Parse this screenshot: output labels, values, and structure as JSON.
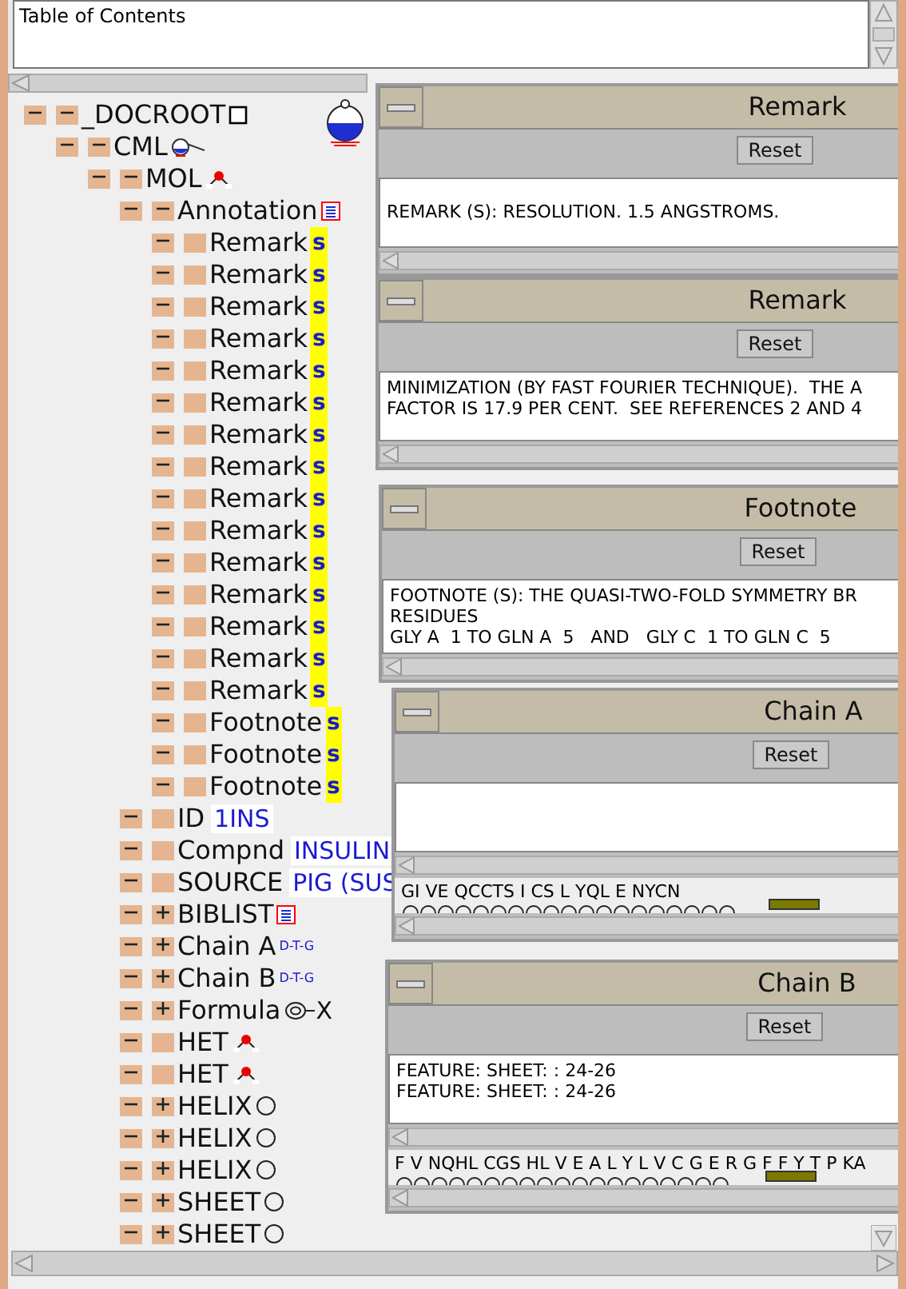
{
  "toc": {
    "title": "Table of Contents"
  },
  "tree": [
    {
      "label": "_DOCROOT",
      "kind": "branch",
      "expanded": true,
      "tag": {
        "kind": "box"
      },
      "children": [
        {
          "label": "CML",
          "kind": "branch",
          "expanded": true,
          "tag": {
            "kind": "flask"
          },
          "children": [
            {
              "label": "MOL",
              "kind": "branch",
              "expanded": true,
              "tag": {
                "kind": "molecule"
              },
              "children": [
                {
                  "label": "Annotation",
                  "kind": "branch",
                  "expanded": true,
                  "tag": {
                    "kind": "list"
                  },
                  "children": [
                    {
                      "label": "Remark",
                      "kind": "leaf",
                      "tag": {
                        "kind": "s",
                        "text": "s"
                      }
                    },
                    {
                      "label": "Remark",
                      "kind": "leaf",
                      "tag": {
                        "kind": "s",
                        "text": "s"
                      }
                    },
                    {
                      "label": "Remark",
                      "kind": "leaf",
                      "tag": {
                        "kind": "s",
                        "text": "s"
                      }
                    },
                    {
                      "label": "Remark",
                      "kind": "leaf",
                      "tag": {
                        "kind": "s",
                        "text": "s"
                      }
                    },
                    {
                      "label": "Remark",
                      "kind": "leaf",
                      "tag": {
                        "kind": "s",
                        "text": "s"
                      }
                    },
                    {
                      "label": "Remark",
                      "kind": "leaf",
                      "tag": {
                        "kind": "s",
                        "text": "s"
                      }
                    },
                    {
                      "label": "Remark",
                      "kind": "leaf",
                      "tag": {
                        "kind": "s",
                        "text": "s"
                      }
                    },
                    {
                      "label": "Remark",
                      "kind": "leaf",
                      "tag": {
                        "kind": "s",
                        "text": "s"
                      }
                    },
                    {
                      "label": "Remark",
                      "kind": "leaf",
                      "tag": {
                        "kind": "s",
                        "text": "s"
                      }
                    },
                    {
                      "label": "Remark",
                      "kind": "leaf",
                      "tag": {
                        "kind": "s",
                        "text": "s"
                      }
                    },
                    {
                      "label": "Remark",
                      "kind": "leaf",
                      "tag": {
                        "kind": "s",
                        "text": "s"
                      }
                    },
                    {
                      "label": "Remark",
                      "kind": "leaf",
                      "tag": {
                        "kind": "s",
                        "text": "s"
                      }
                    },
                    {
                      "label": "Remark",
                      "kind": "leaf",
                      "tag": {
                        "kind": "s",
                        "text": "s"
                      }
                    },
                    {
                      "label": "Remark",
                      "kind": "leaf",
                      "tag": {
                        "kind": "s",
                        "text": "s"
                      }
                    },
                    {
                      "label": "Remark",
                      "kind": "leaf",
                      "tag": {
                        "kind": "s",
                        "text": "s"
                      }
                    },
                    {
                      "label": "Footnote",
                      "kind": "leaf",
                      "tag": {
                        "kind": "s",
                        "text": "s"
                      }
                    },
                    {
                      "label": "Footnote",
                      "kind": "leaf",
                      "tag": {
                        "kind": "s",
                        "text": "s"
                      }
                    },
                    {
                      "label": "Footnote",
                      "kind": "leaf",
                      "tag": {
                        "kind": "s",
                        "text": "s"
                      }
                    }
                  ]
                },
                {
                  "label": "ID",
                  "kind": "leaf",
                  "tag": {
                    "kind": "value",
                    "text": "1INS"
                  }
                },
                {
                  "label": "Compnd",
                  "kind": "leaf",
                  "tag": {
                    "kind": "value",
                    "text": "INSULIN"
                  }
                },
                {
                  "label": "SOURCE",
                  "kind": "leaf",
                  "tag": {
                    "kind": "value",
                    "text": "PIG (SUS"
                  }
                },
                {
                  "label": "BIBLIST",
                  "kind": "branch",
                  "expanded": false,
                  "tag": {
                    "kind": "list"
                  }
                },
                {
                  "label": "Chain A",
                  "kind": "branch",
                  "expanded": false,
                  "tag": {
                    "kind": "dtg",
                    "text": "D-T-G"
                  }
                },
                {
                  "label": "Chain B",
                  "kind": "branch",
                  "expanded": false,
                  "tag": {
                    "kind": "dtg",
                    "text": "D-T-G"
                  }
                },
                {
                  "label": "Formula",
                  "kind": "branch",
                  "expanded": false,
                  "tag": {
                    "kind": "formula",
                    "text": "X"
                  }
                },
                {
                  "label": "HET",
                  "kind": "leaf",
                  "tag": {
                    "kind": "molecule"
                  }
                },
                {
                  "label": "HET",
                  "kind": "leaf",
                  "tag": {
                    "kind": "molecule"
                  }
                },
                {
                  "label": "HELIX",
                  "kind": "branch",
                  "expanded": false,
                  "tag": {
                    "kind": "circle"
                  }
                },
                {
                  "label": "HELIX",
                  "kind": "branch",
                  "expanded": false,
                  "tag": {
                    "kind": "circle"
                  }
                },
                {
                  "label": "HELIX",
                  "kind": "branch",
                  "expanded": false,
                  "tag": {
                    "kind": "circle"
                  }
                },
                {
                  "label": "SHEET",
                  "kind": "branch",
                  "expanded": false,
                  "tag": {
                    "kind": "circle"
                  }
                },
                {
                  "label": "SHEET",
                  "kind": "branch",
                  "expanded": false,
                  "tag": {
                    "kind": "circle"
                  }
                }
              ]
            }
          ]
        }
      ]
    }
  ],
  "windows": [
    {
      "kind": "notes",
      "title": "Remark",
      "button": "Reset",
      "lines": [
        "REMARK (S): RESOLUTION. 1.5 ANGSTROMS."
      ]
    },
    {
      "kind": "notes",
      "title": "Remark",
      "button": "Reset",
      "lines": [
        "MINIMIZATION (BY FAST FOURIER TECHNIQUE).  THE A",
        "FACTOR IS 17.9 PER CENT.  SEE REFERENCES 2 AND 4"
      ]
    },
    {
      "kind": "notes",
      "title": "Footnote",
      "button": "Reset",
      "lines": [
        "FOOTNOTE (S): THE QUASI-TWO-FOLD SYMMETRY BR",
        "RESIDUES",
        "GLY A  1 TO GLN A  5   AND   GLY C  1 TO GLN C  5"
      ]
    },
    {
      "kind": "chain",
      "title": "Chain A",
      "button": "Reset",
      "sequence": "GI VE QCCTS I CS L YQL E NYCN"
    },
    {
      "kind": "chain",
      "title": "Chain B",
      "button": "Reset",
      "lines": [
        "FEATURE: SHEET: : 24-26",
        "FEATURE: SHEET: : 24-26"
      ],
      "sequence": "F V NQHL CGS HL V E A L Y L V C G E R G F F Y T P KA"
    }
  ]
}
